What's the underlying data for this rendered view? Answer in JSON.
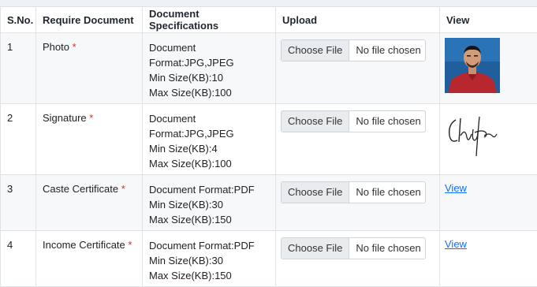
{
  "headers": {
    "sno": "S.No.",
    "document": "Require Document",
    "specs": "Document Specifications",
    "upload": "Upload",
    "view": "View"
  },
  "rows": [
    {
      "sno": "1",
      "document": "Photo",
      "required_mark": "*",
      "spec_lines": [
        "Document",
        "Format:JPG,JPEG",
        "Min Size(KB):10",
        "Max Size(KB):100"
      ],
      "upload_button": "Choose File",
      "upload_status": "No file chosen",
      "view": "photo-thumbnail"
    },
    {
      "sno": "2",
      "document": "Signature",
      "required_mark": "*",
      "spec_lines": [
        "Document",
        "Format:JPG,JPEG",
        "Min Size(KB):4",
        "Max Size(KB):100"
      ],
      "upload_button": "Choose File",
      "upload_status": "No file chosen",
      "view": "signature-thumbnail"
    },
    {
      "sno": "3",
      "document": "Caste Certificate",
      "required_mark": "*",
      "spec_lines": [
        "Document Format:PDF",
        "Min Size(KB):30",
        "Max Size(KB):150"
      ],
      "upload_button": "Choose File",
      "upload_status": "No file chosen",
      "view_link": "View"
    },
    {
      "sno": "4",
      "document": "Income Certificate",
      "required_mark": "*",
      "spec_lines": [
        "Document Format:PDF",
        "Min Size(KB):30",
        "Max Size(KB):150"
      ],
      "upload_button": "Choose File",
      "upload_status": "No file chosen",
      "view_link": "View"
    }
  ],
  "colors": {
    "required": "#d32f2f",
    "link": "#0d6efd",
    "border": "#dfe3e8",
    "stripe": "#f7f8fa"
  }
}
